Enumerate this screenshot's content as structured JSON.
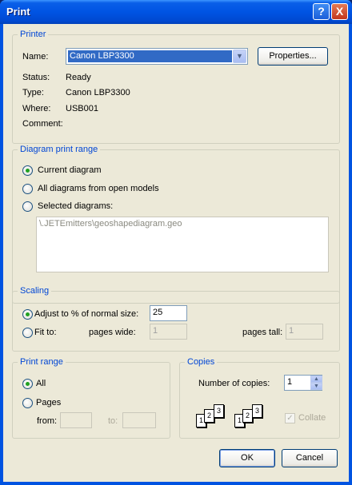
{
  "window": {
    "title": "Print",
    "help_glyph": "?",
    "close_glyph": "X"
  },
  "printer": {
    "legend": "Printer",
    "name_label": "Name:",
    "name_value": "Canon LBP3300",
    "properties_button": "Properties...",
    "status_label": "Status:",
    "status_value": "Ready",
    "type_label": "Type:",
    "type_value": "Canon LBP3300",
    "where_label": "Where:",
    "where_value": "USB001",
    "comment_label": "Comment:",
    "comment_value": ""
  },
  "diagram_range": {
    "legend": "Diagram print range",
    "options": [
      "Current diagram",
      "All diagrams from open models",
      "Selected diagrams:"
    ],
    "selected_index": 0,
    "selected_list": [
      "\\.JETEmitters\\geoshapediagram.geo"
    ]
  },
  "scaling": {
    "legend": "Scaling",
    "adjust_label": "Adjust to % of normal size:",
    "adjust_value": "25",
    "fit_label": "Fit to:",
    "pages_wide_label": "pages wide:",
    "pages_wide_value": "1",
    "pages_tall_label": "pages tall:",
    "pages_tall_value": "1",
    "selected": "adjust"
  },
  "print_range": {
    "legend": "Print range",
    "all_label": "All",
    "pages_label": "Pages",
    "from_label": "from:",
    "to_label": "to:",
    "from_value": "",
    "to_value": "",
    "selected": "all"
  },
  "copies": {
    "legend": "Copies",
    "number_label": "Number of copies:",
    "number_value": "1",
    "collate_label": "Collate",
    "collate_checked": true,
    "page_numbers": [
      "1",
      "2",
      "3"
    ]
  },
  "buttons": {
    "ok": "OK",
    "cancel": "Cancel"
  }
}
